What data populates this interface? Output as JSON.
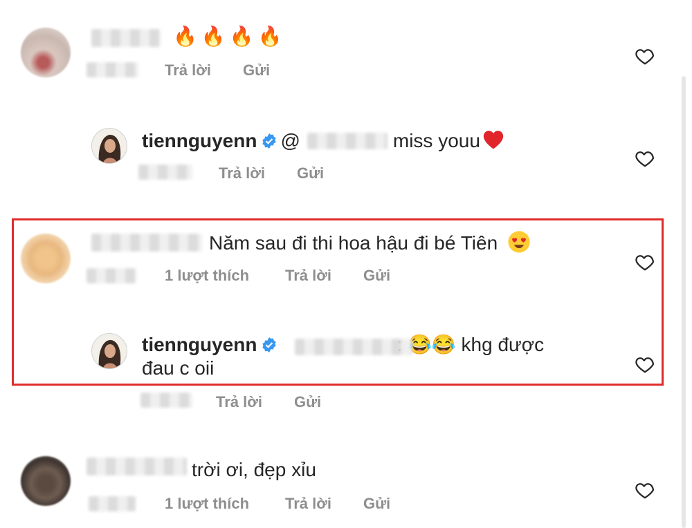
{
  "colors": {
    "text": "#262626",
    "meta": "#8e8e8e",
    "highlight": "#e02b2b",
    "verified": "#3897f0"
  },
  "comments": [
    {
      "text": "🔥🔥🔥🔥",
      "reply_label": "Trả lời",
      "send_label": "Gửi"
    },
    {
      "username": "tiennguyenn",
      "mention": "@",
      "text": "miss youu",
      "reply_label": "Trả lời",
      "send_label": "Gửi"
    },
    {
      "text": "Năm sau đi thi hoa hậu đi bé Tiên",
      "likes": "1 lượt thích",
      "reply_label": "Trả lời",
      "send_label": "Gửi"
    },
    {
      "username": "tiennguyenn",
      "text_line1": ": 😂😂 khg được",
      "text_line2": "đau c oii",
      "reply_label": "Trả lời",
      "send_label": "Gửi"
    },
    {
      "text": "trời ơi, đẹp xỉu",
      "likes": "1 lượt thích",
      "reply_label": "Trả lời",
      "send_label": "Gửi"
    }
  ],
  "icons": [
    "heart-icon",
    "verified-badge-icon",
    "fire-emoji",
    "heart-eyes-emoji",
    "tears-of-joy-emoji",
    "red-heart-emoji"
  ]
}
